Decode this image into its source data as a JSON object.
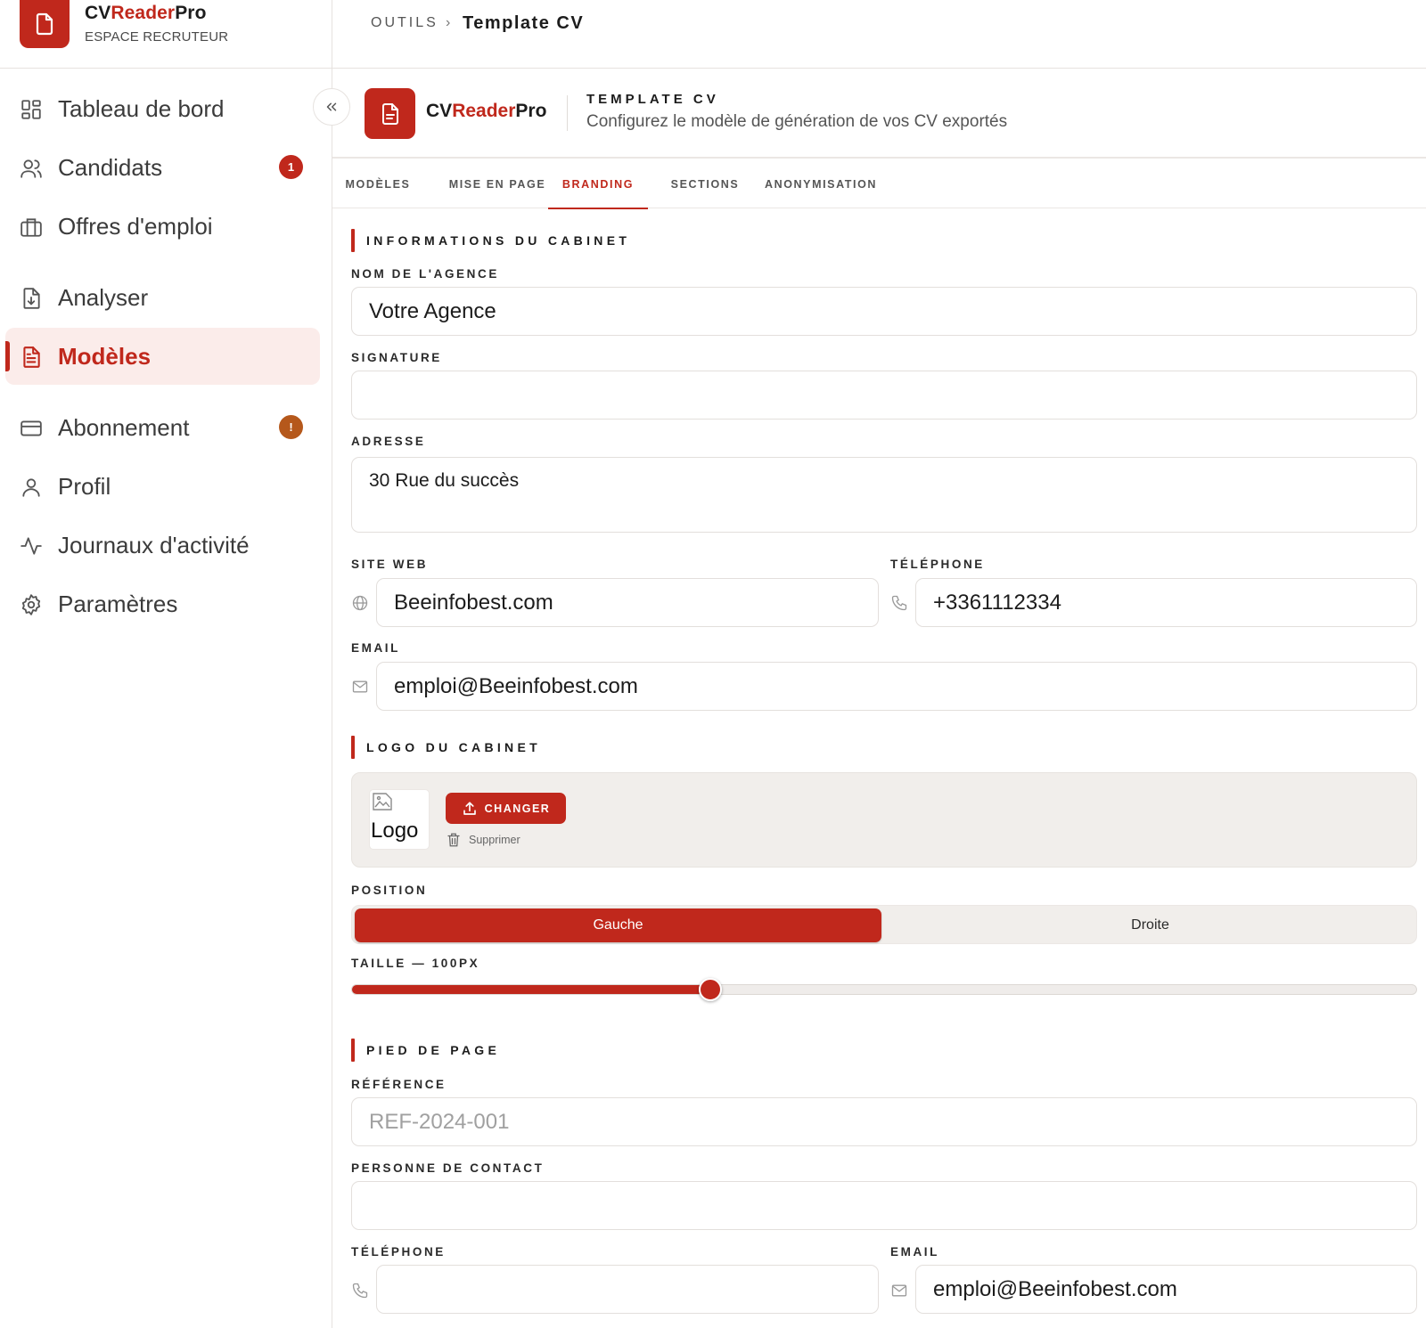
{
  "brand": {
    "name_part1": "CV",
    "name_part2": "Reader",
    "name_part3": "Pro",
    "subtitle": "ESPACE RECRUTEUR"
  },
  "sidebar": {
    "items": [
      {
        "label": "Tableau de bord",
        "icon": "grid-icon"
      },
      {
        "label": "Candidats",
        "icon": "users-icon",
        "badge": "1"
      },
      {
        "label": "Offres d'emploi",
        "icon": "briefcase-icon"
      },
      {
        "label": "Analyser",
        "icon": "file-download-icon"
      },
      {
        "label": "Modèles",
        "icon": "file-text-icon",
        "active": true
      },
      {
        "label": "Abonnement",
        "icon": "credit-card-icon",
        "badge": "!"
      },
      {
        "label": "Profil",
        "icon": "user-icon"
      },
      {
        "label": "Journaux d'activité",
        "icon": "activity-icon"
      },
      {
        "label": "Paramètres",
        "icon": "gear-icon"
      }
    ]
  },
  "breadcrumb": {
    "root": "OUTILS",
    "separator": "›",
    "current": "Template CV"
  },
  "page_header": {
    "title": "TEMPLATE CV",
    "subtitle": "Configurez le modèle de génération de vos CV exportés"
  },
  "tabs": [
    {
      "label": "MODÈLES"
    },
    {
      "label": "MISE EN PAGE"
    },
    {
      "label": "BRANDING",
      "active": true
    },
    {
      "label": "SECTIONS"
    },
    {
      "label": "ANONYMISATION"
    }
  ],
  "cabinet": {
    "section_title": "INFORMATIONS DU CABINET",
    "agency_label": "NOM DE L'AGENCE",
    "agency_value": "Votre Agence",
    "signature_label": "SIGNATURE",
    "signature_value": "",
    "address_label": "ADRESSE",
    "address_value": "30 Rue du succès",
    "website_label": "SITE WEB",
    "website_value": "Beeinfobest.com",
    "phone_label": "TÉLÉPHONE",
    "phone_value": "+3361112334",
    "email_label": "EMAIL",
    "email_value": "emploi@Beeinfobest.com"
  },
  "logo": {
    "section_title": "LOGO DU CABINET",
    "alt_text": "Logo",
    "change_label": "CHANGER",
    "delete_label": "Supprimer",
    "position_label": "POSITION",
    "position_options": [
      "Gauche",
      "Droite"
    ],
    "position_selected": "Gauche",
    "size_label": "TAILLE — 100PX",
    "size_fraction": 0.337
  },
  "footer": {
    "section_title": "PIED DE PAGE",
    "reference_label": "RÉFÉRENCE",
    "reference_placeholder": "REF-2024-001",
    "contact_label": "PERSONNE DE CONTACT",
    "contact_value": "",
    "phone_label": "TÉLÉPHONE",
    "phone_value": "",
    "email_label": "EMAIL",
    "email_value": "emploi@Beeinfobest.com"
  },
  "colors": {
    "accent": "#c0281c",
    "active_bg": "#fbecea",
    "badge_red": "#c0281c",
    "badge_orange": "#b5581b"
  }
}
